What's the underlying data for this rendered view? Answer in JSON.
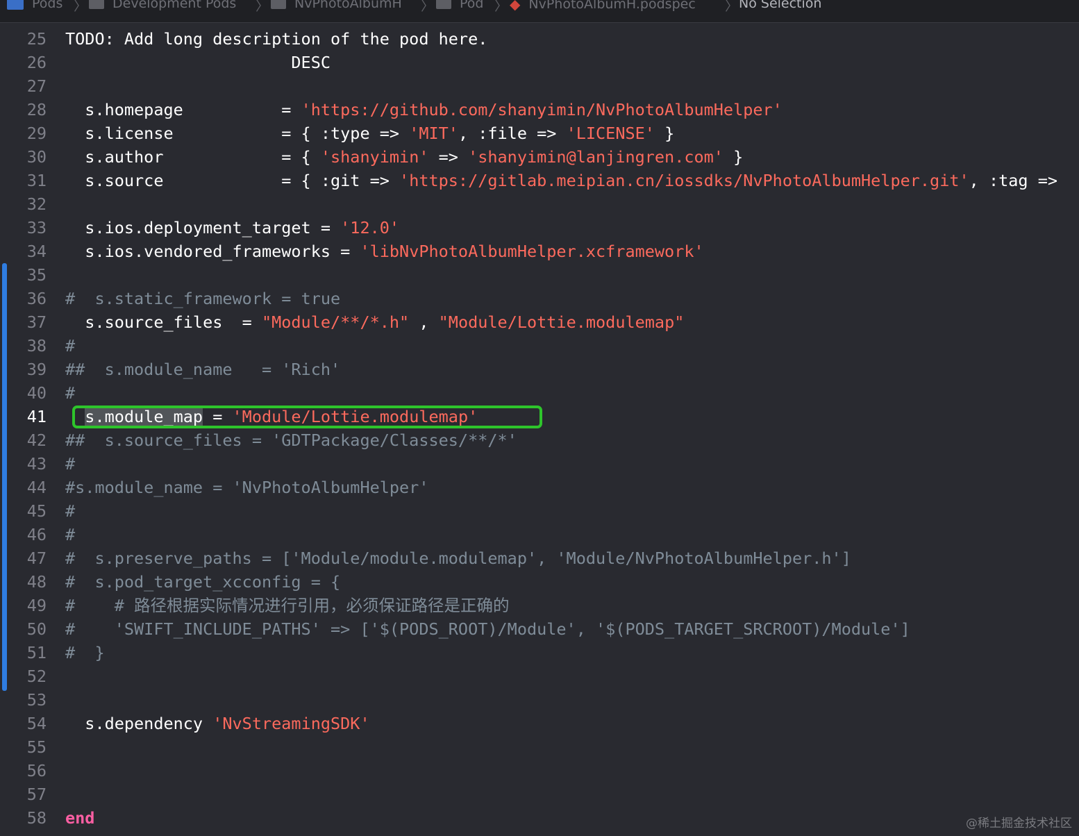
{
  "jumpbar": {
    "crumbs": [
      "Pods",
      "Development Pods",
      "NvPhotoAlbumH",
      "Pod",
      "NvPhotoAlbumH.podspec",
      "No Selection"
    ]
  },
  "editor": {
    "current_line": "41",
    "lines": [
      {
        "n": "25",
        "parts": [
          {
            "c": "TODO: Add long description of the pod here."
          }
        ]
      },
      {
        "n": "26",
        "parts": [
          {
            "c": "                       DESC"
          }
        ]
      },
      {
        "n": "27",
        "parts": []
      },
      {
        "n": "28",
        "parts": [
          {
            "c": "  s.homepage          = "
          },
          {
            "c": "'https://github.com/shanyimin/NvPhotoAlbumHelper'",
            "t": "str"
          }
        ]
      },
      {
        "n": "29",
        "parts": [
          {
            "c": "  s.license           = { :type => "
          },
          {
            "c": "'MIT'",
            "t": "str"
          },
          {
            "c": ", :file => "
          },
          {
            "c": "'LICENSE'",
            "t": "str"
          },
          {
            "c": " }"
          }
        ]
      },
      {
        "n": "30",
        "parts": [
          {
            "c": "  s.author            = { "
          },
          {
            "c": "'shanyimin'",
            "t": "str"
          },
          {
            "c": " => "
          },
          {
            "c": "'shanyimin@lanjingren.com'",
            "t": "str"
          },
          {
            "c": " }"
          }
        ]
      },
      {
        "n": "31",
        "parts": [
          {
            "c": "  s.source            = { :git => "
          },
          {
            "c": "'https://gitlab.meipian.cn/iossdks/NvPhotoAlbumHelper.git'",
            "t": "str"
          },
          {
            "c": ", :tag =>"
          }
        ]
      },
      {
        "n": "32",
        "parts": []
      },
      {
        "n": "33",
        "parts": [
          {
            "c": "  s.ios.deployment_target = "
          },
          {
            "c": "'12.0'",
            "t": "str"
          }
        ]
      },
      {
        "n": "34",
        "parts": [
          {
            "c": "  s.ios.vendored_frameworks = "
          },
          {
            "c": "'libNvPhotoAlbumHelper.xcframework'",
            "t": "str"
          }
        ]
      },
      {
        "n": "35",
        "parts": []
      },
      {
        "n": "36",
        "parts": [
          {
            "c": "#  s.static_framework = true",
            "t": "cmt"
          }
        ]
      },
      {
        "n": "37",
        "parts": [
          {
            "c": "  s.source_files  = "
          },
          {
            "c": "\"Module/**/*.h\"",
            "t": "str"
          },
          {
            "c": " , "
          },
          {
            "c": "\"Module/Lottie.modulemap\"",
            "t": "str"
          }
        ]
      },
      {
        "n": "38",
        "parts": [
          {
            "c": "#",
            "t": "cmt"
          }
        ]
      },
      {
        "n": "39",
        "parts": [
          {
            "c": "##  s.module_name   = 'Rich'",
            "t": "cmt"
          }
        ]
      },
      {
        "n": "40",
        "parts": [
          {
            "c": "#",
            "t": "cmt"
          }
        ]
      },
      {
        "n": "41",
        "parts": [
          {
            "c": "  "
          },
          {
            "c": "s.module_map",
            "t": "sel"
          },
          {
            "c": " = "
          },
          {
            "c": "'Module/Lottie.modulemap'",
            "t": "str"
          }
        ]
      },
      {
        "n": "42",
        "parts": [
          {
            "c": "##  s.source_files = 'GDTPackage/Classes/**/*'",
            "t": "cmt"
          }
        ]
      },
      {
        "n": "43",
        "parts": [
          {
            "c": "#",
            "t": "cmt"
          }
        ]
      },
      {
        "n": "44",
        "parts": [
          {
            "c": "#s.module_name = 'NvPhotoAlbumHelper'",
            "t": "cmt"
          }
        ]
      },
      {
        "n": "45",
        "parts": [
          {
            "c": "#",
            "t": "cmt"
          }
        ]
      },
      {
        "n": "46",
        "parts": [
          {
            "c": "#",
            "t": "cmt"
          }
        ]
      },
      {
        "n": "47",
        "parts": [
          {
            "c": "#  s.preserve_paths = ['Module/module.modulemap', 'Module/NvPhotoAlbumHelper.h']",
            "t": "cmt"
          }
        ]
      },
      {
        "n": "48",
        "parts": [
          {
            "c": "#  s.pod_target_xcconfig = {",
            "t": "cmt"
          }
        ]
      },
      {
        "n": "49",
        "parts": [
          {
            "c": "#    # 路径根据实际情况进行引用，必须保证路径是正确的",
            "t": "cmt"
          }
        ]
      },
      {
        "n": "50",
        "parts": [
          {
            "c": "#    'SWIFT_INCLUDE_PATHS' => ['$(PODS_ROOT)/Module', '$(PODS_TARGET_SRCROOT)/Module']",
            "t": "cmt"
          }
        ]
      },
      {
        "n": "51",
        "parts": [
          {
            "c": "#  }",
            "t": "cmt"
          }
        ]
      },
      {
        "n": "52",
        "parts": []
      },
      {
        "n": "53",
        "parts": []
      },
      {
        "n": "54",
        "parts": [
          {
            "c": "  s.dependency "
          },
          {
            "c": "'NvStreamingSDK'",
            "t": "str"
          }
        ]
      },
      {
        "n": "55",
        "parts": []
      },
      {
        "n": "56",
        "parts": []
      },
      {
        "n": "57",
        "parts": []
      },
      {
        "n": "58",
        "parts": [
          {
            "c": "end",
            "t": "kw"
          }
        ]
      }
    ]
  },
  "watermark": "@稀土掘金技术社区"
}
